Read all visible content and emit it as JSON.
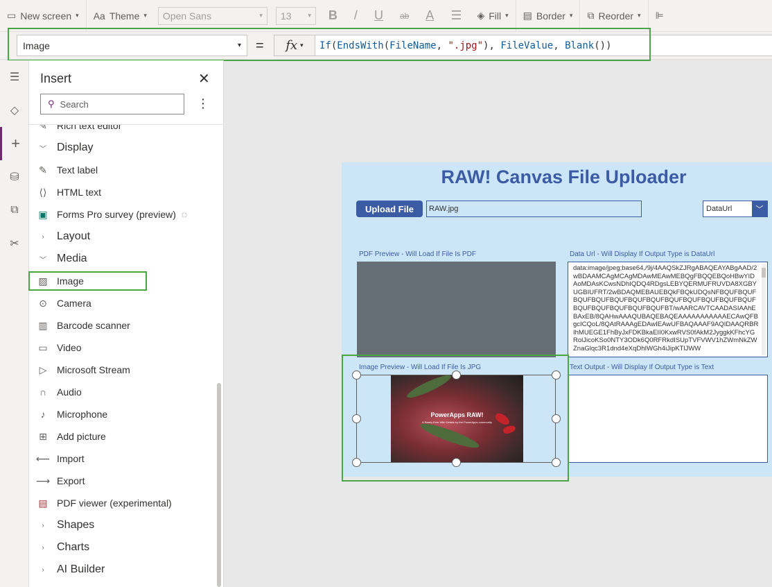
{
  "ribbon": {
    "new_screen": "New screen",
    "theme": "Theme",
    "font": "Open Sans",
    "font_size": "13",
    "bold": "B",
    "italic": "/",
    "underline": "U",
    "strike": "ab",
    "font_color": "A",
    "fill": "Fill",
    "border": "Border",
    "reorder": "Reorder"
  },
  "formula_bar": {
    "property": "Image",
    "equals": "=",
    "fx": "fx",
    "formula": "If(EndsWith(FileName, \".jpg\"), FileValue, Blank())"
  },
  "insert_panel": {
    "title": "Insert",
    "search_placeholder": "Search",
    "items": [
      {
        "label": "Rich text editor",
        "icon": "pen-icon",
        "kind": "item"
      },
      {
        "label": "Display",
        "icon": "chevron-down-icon",
        "kind": "category"
      },
      {
        "label": "Text label",
        "icon": "text-label-icon",
        "kind": "item"
      },
      {
        "label": "HTML text",
        "icon": "html-icon",
        "kind": "item"
      },
      {
        "label": "Forms Pro survey (preview)",
        "icon": "forms-icon",
        "kind": "item"
      },
      {
        "label": "Layout",
        "icon": "chevron-right-icon",
        "kind": "category"
      },
      {
        "label": "Media",
        "icon": "chevron-down-icon",
        "kind": "category"
      },
      {
        "label": "Image",
        "icon": "image-icon",
        "kind": "item"
      },
      {
        "label": "Camera",
        "icon": "camera-icon",
        "kind": "item"
      },
      {
        "label": "Barcode scanner",
        "icon": "barcode-icon",
        "kind": "item"
      },
      {
        "label": "Video",
        "icon": "video-icon",
        "kind": "item"
      },
      {
        "label": "Microsoft Stream",
        "icon": "stream-icon",
        "kind": "item"
      },
      {
        "label": "Audio",
        "icon": "headphones-icon",
        "kind": "item"
      },
      {
        "label": "Microphone",
        "icon": "microphone-icon",
        "kind": "item"
      },
      {
        "label": "Add picture",
        "icon": "add-picture-icon",
        "kind": "item"
      },
      {
        "label": "Import",
        "icon": "import-icon",
        "kind": "item"
      },
      {
        "label": "Export",
        "icon": "export-icon",
        "kind": "item"
      },
      {
        "label": "PDF viewer (experimental)",
        "icon": "pdf-icon",
        "kind": "item"
      },
      {
        "label": "Shapes",
        "icon": "chevron-right-icon",
        "kind": "category"
      },
      {
        "label": "Charts",
        "icon": "chevron-right-icon",
        "kind": "category"
      },
      {
        "label": "AI Builder",
        "icon": "chevron-right-icon",
        "kind": "category"
      }
    ]
  },
  "app": {
    "title": "RAW! Canvas File Uploader",
    "upload_button": "Upload File",
    "filename": "RAW.jpg",
    "output_type": "DataUrl",
    "pdf_label": "PDF Preview - Will Load If File Is PDF",
    "dataurl_label": "Data Url - Will Display If Output Type is DataUrl",
    "image_label": "Image Preview - Will Load If File Is JPG",
    "text_label": "Text Output - Will Display If Output Type is Text",
    "dataurl_text": "data:image/jpeg;base64,/9j/4AAQSkZJRgABAQEAYABgAAD/2wBDAAMCAgMCAgMDAwMEAwMEBQgFBQQEBQoHBwYIDAoMDAsKCwsNDhIQDQ4RDgsLEBYQERMUFRUVDA8XGBYUGBIUFRT/2wBDAQMEBAUEBQkFBQkUDQsNFBQUFBQUFBQUFBQUFBQUFBQUFBQUFBQUFBQUFBQUFBQUFBQUFBQUFBQUFBQUFBQUFBQUFBT/wAARCAVTCAADASIAAhEBAxEB/8QAHwAAAQUBAQEBAQEAAAAAAAAAAAECAwQFBgcICQoL/8QAtRAAAgEDAwIEAwUFBAQAAAF9AQIDAAQRBRIhMUEGE1FhByJxFDKBkaEII0KxwRVS0fAkM2JyggkKFhcYGRolJicoKSo0NTY3ODk6Q0RFRkdISUpTVFVWV1hZWmNkZWZnaGlqc3R1dnd4eXqDhIWGh4iJipKTlJWW",
    "photo_title": "PowerApps RAW!",
    "photo_sub": "A Rarely Ever With Details by the PowerApps community"
  }
}
